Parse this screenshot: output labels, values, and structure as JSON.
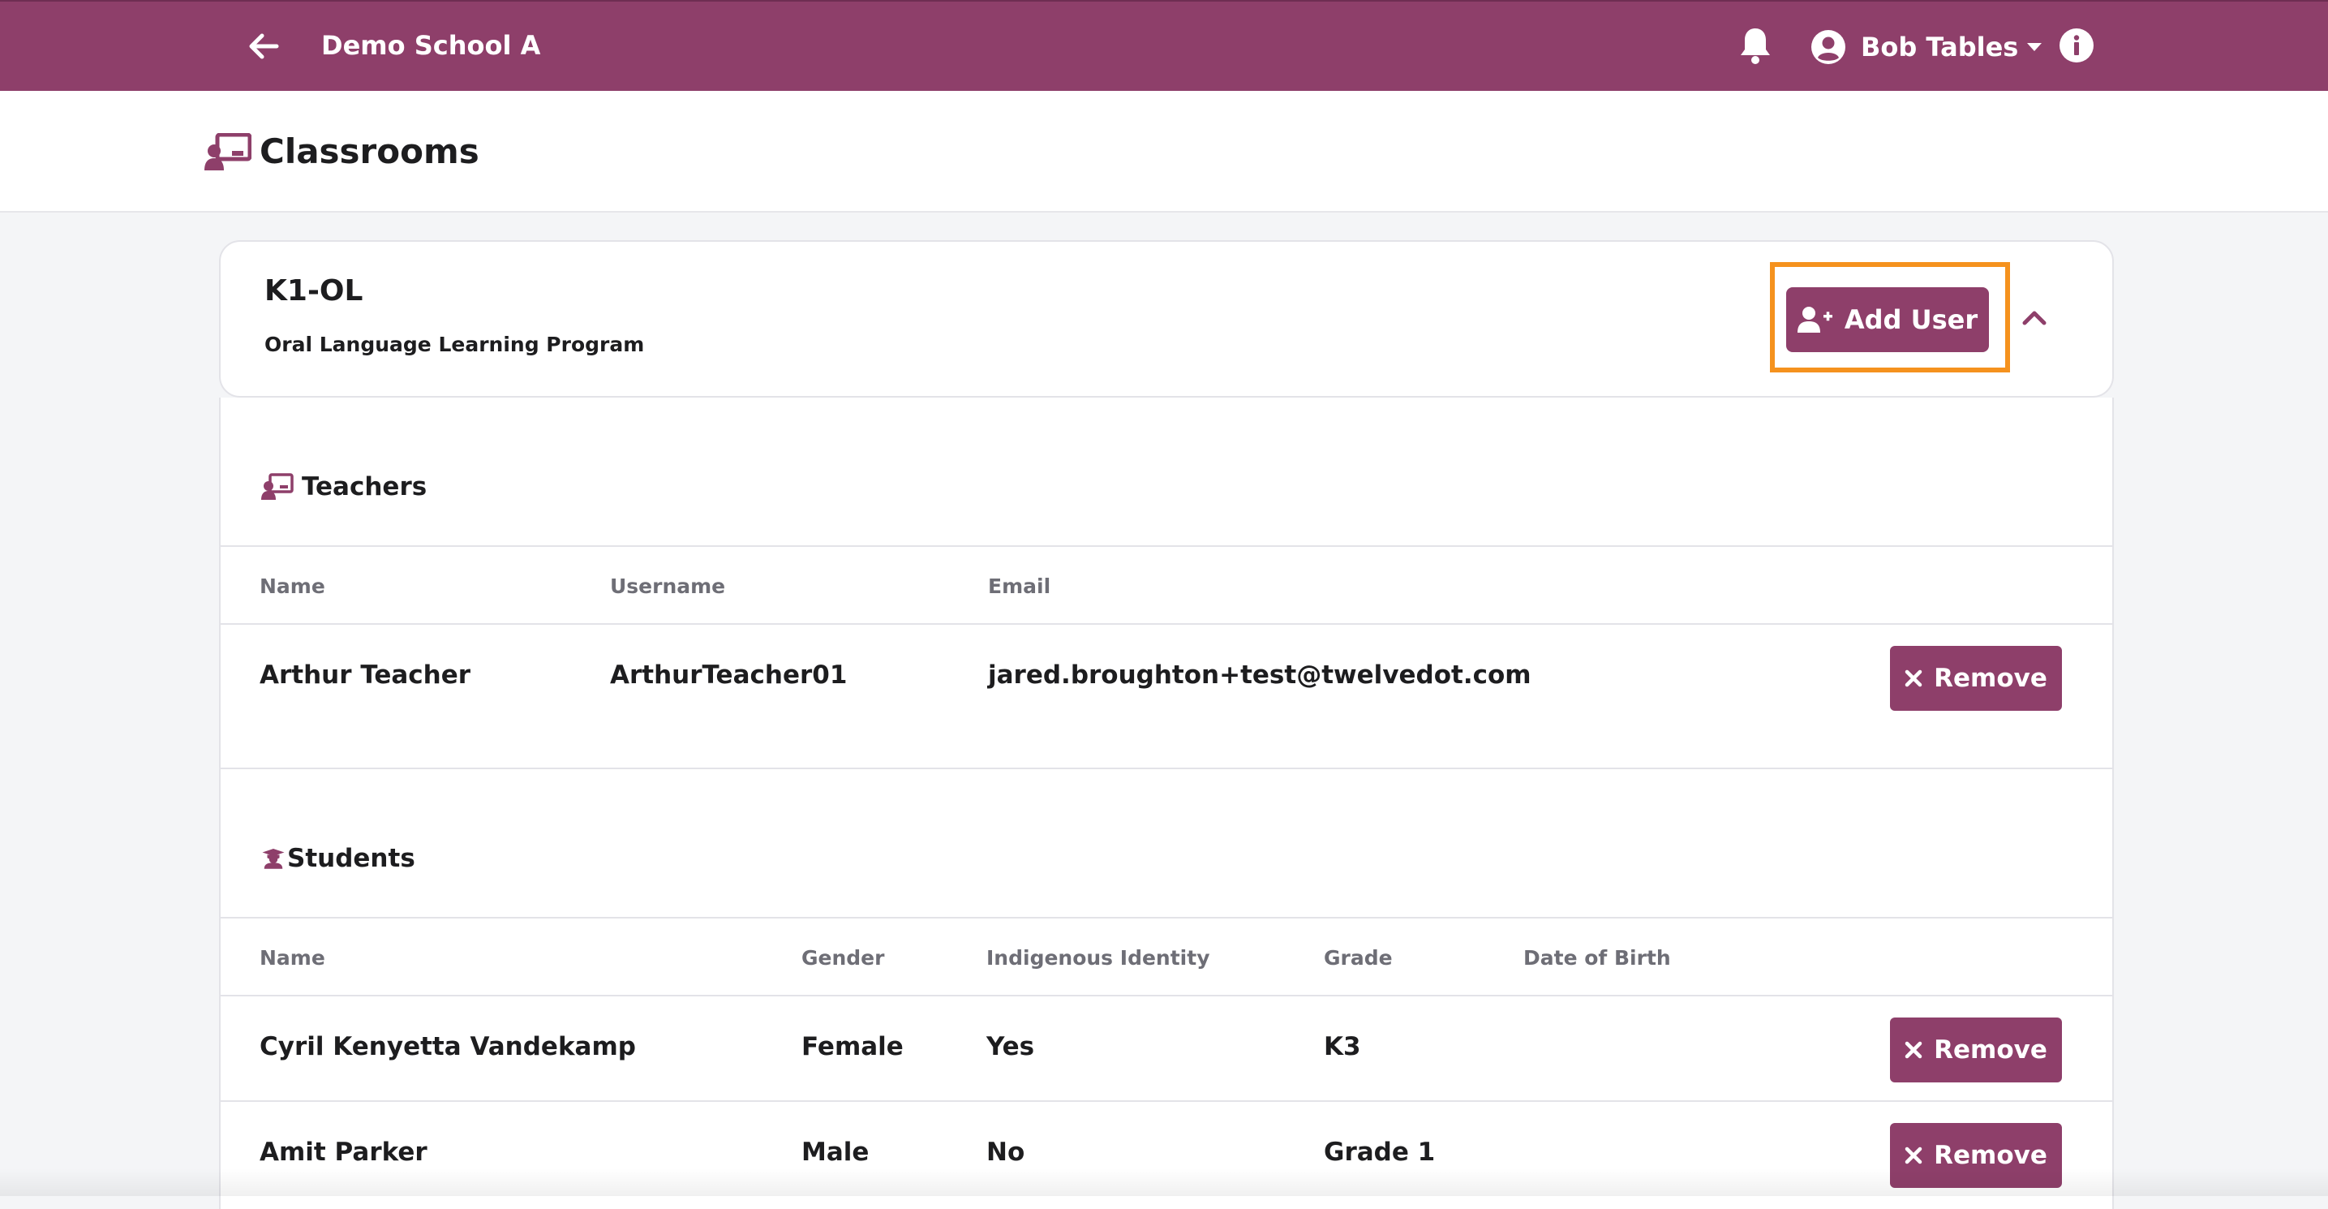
{
  "topbar": {
    "school": "Demo School A",
    "user": "Bob Tables"
  },
  "page": {
    "title": "Classrooms"
  },
  "classroom": {
    "code": "K1-OL",
    "description": "Oral Language Learning Program",
    "add_user_label": "Add User"
  },
  "teachers": {
    "title": "Teachers",
    "columns": [
      "Name",
      "Username",
      "Email"
    ],
    "rows": [
      {
        "name": "Arthur Teacher",
        "username": "ArthurTeacher01",
        "email": "jared.broughton+test@twelvedot.com",
        "action": "Remove"
      }
    ]
  },
  "students": {
    "title": "Students",
    "columns": [
      "Name",
      "Gender",
      "Indigenous Identity",
      "Grade",
      "Date of Birth"
    ],
    "rows": [
      {
        "name": "Cyril Kenyetta Vandekamp",
        "gender": "Female",
        "indigenous": "Yes",
        "grade": "K3",
        "dob": "",
        "action": "Remove"
      },
      {
        "name": "Amit Parker",
        "gender": "Male",
        "indigenous": "No",
        "grade": "Grade 1",
        "dob": "",
        "action": "Remove"
      }
    ]
  },
  "colors": {
    "brand": "#8e3f6a",
    "highlight": "#f5921e",
    "background": "#f4f5f7"
  },
  "icons": [
    "back-arrow-icon",
    "bell-icon",
    "user-circle-icon",
    "caret-down-icon",
    "info-icon",
    "classroom-icon",
    "user-plus-icon",
    "chevron-up-icon",
    "teacher-icon",
    "student-icon",
    "close-icon"
  ]
}
